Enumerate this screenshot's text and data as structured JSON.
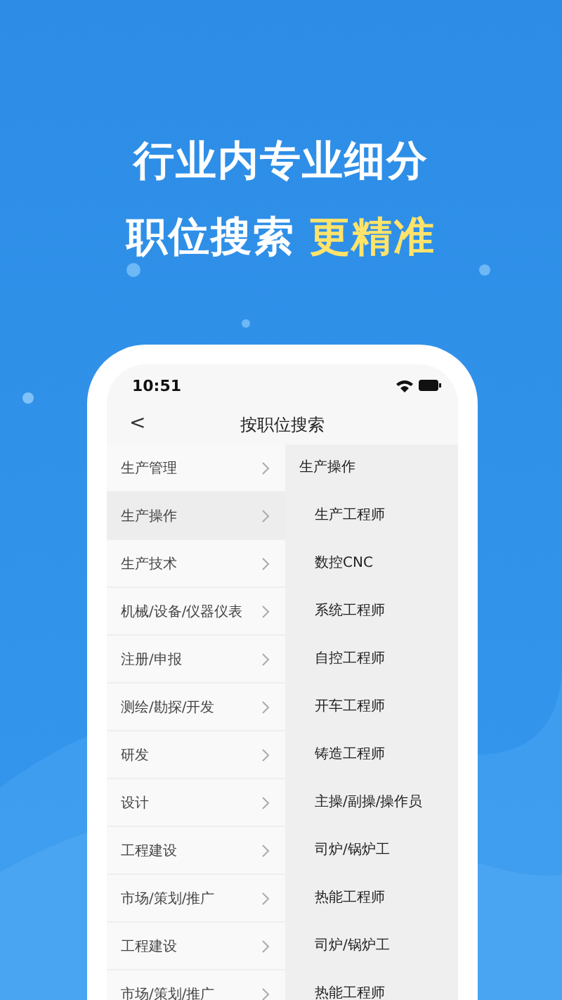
{
  "headline": {
    "line_1": [
      {
        "text": "行业内专业细分",
        "highlight": false
      }
    ],
    "line_2": [
      {
        "text": "职位搜索",
        "highlight": false
      },
      {
        "text": "更精准",
        "highlight": true
      }
    ]
  },
  "status_bar": {
    "time": "10:51"
  },
  "nav": {
    "back": "<",
    "title": "按职位搜索"
  },
  "categories": [
    {
      "label": "生产管理",
      "selected": false
    },
    {
      "label": "生产操作",
      "selected": true
    },
    {
      "label": "生产技术",
      "selected": false
    },
    {
      "label": "机械/设备/仪器仪表",
      "selected": false
    },
    {
      "label": "注册/申报",
      "selected": false
    },
    {
      "label": "测绘/勘探/开发",
      "selected": false
    },
    {
      "label": "研发",
      "selected": false
    },
    {
      "label": "设计",
      "selected": false
    },
    {
      "label": "工程建设",
      "selected": false
    },
    {
      "label": "市场/策划/推广",
      "selected": false
    },
    {
      "label": "工程建设",
      "selected": false
    },
    {
      "label": "市场/策划/推广",
      "selected": false
    }
  ],
  "positions_header": "生产操作",
  "positions": [
    "生产工程师",
    "数控CNC",
    "系统工程师",
    "自控工程师",
    "开车工程师",
    "铸造工程师",
    "主操/副操/操作员",
    "司炉/锅炉工",
    "热能工程师",
    "司炉/锅炉工",
    "热能工程师"
  ]
}
